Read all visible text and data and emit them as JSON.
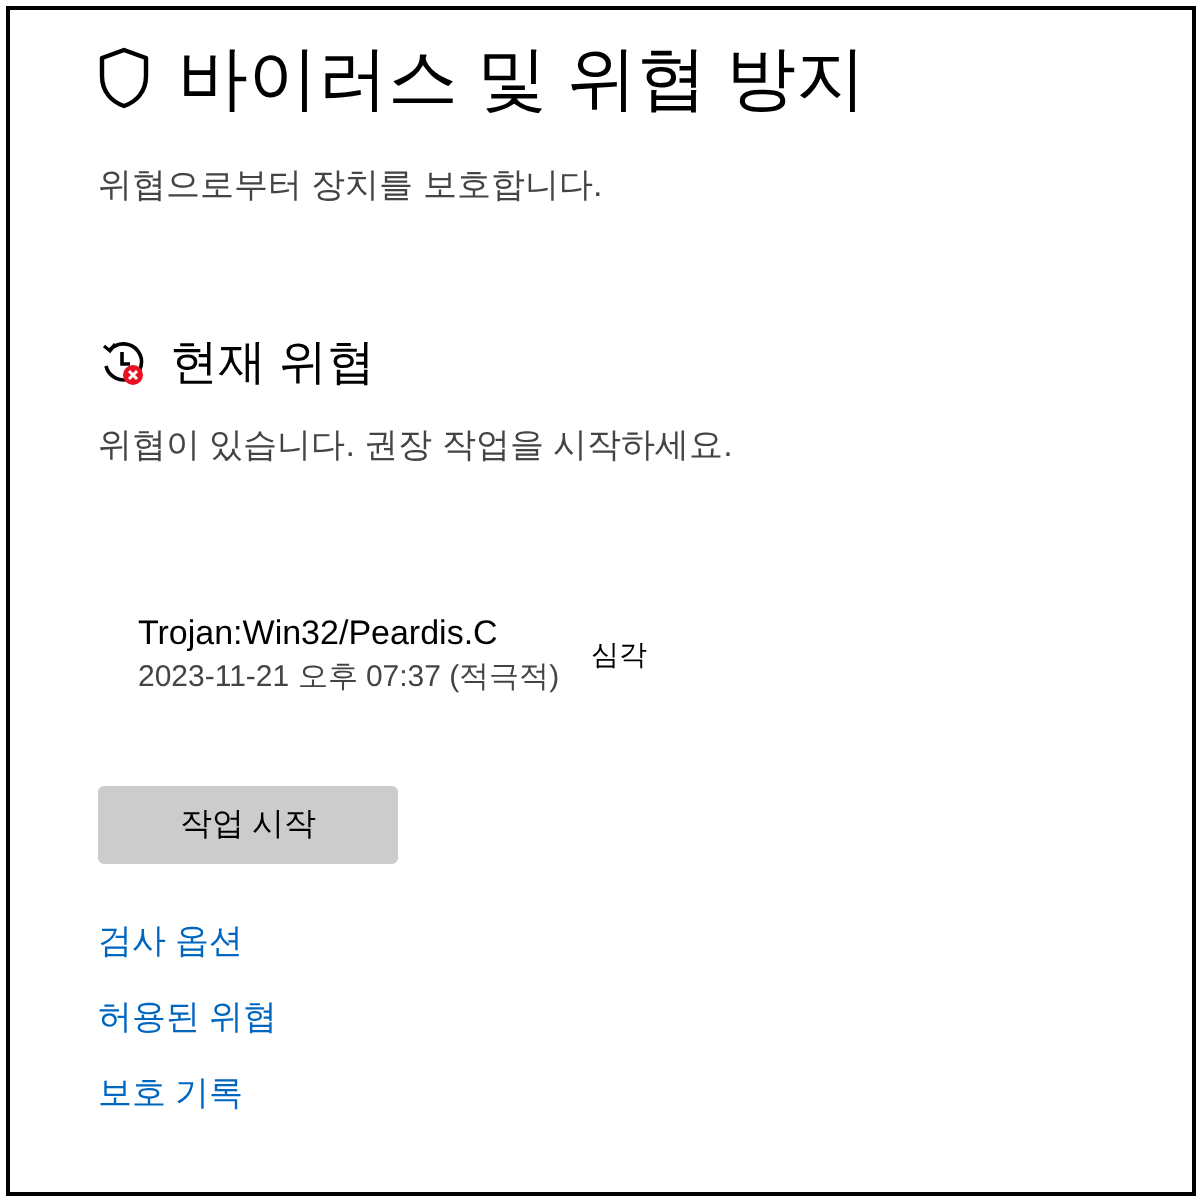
{
  "page": {
    "title": "바이러스 및 위협 방지",
    "subtitle": "위협으로부터 장치를 보호합니다."
  },
  "current_threats": {
    "heading": "현재 위협",
    "message": "위협이 있습니다. 권장 작업을 시작하세요.",
    "threats": [
      {
        "name": "Trojan:Win32/Peardis.C",
        "detected": "2023-11-21 오후 07:37 (적극적)",
        "severity": "심각"
      }
    ],
    "action_button": "작업 시작"
  },
  "links": [
    "검사 옵션",
    "허용된 위협",
    "보호 기록"
  ]
}
